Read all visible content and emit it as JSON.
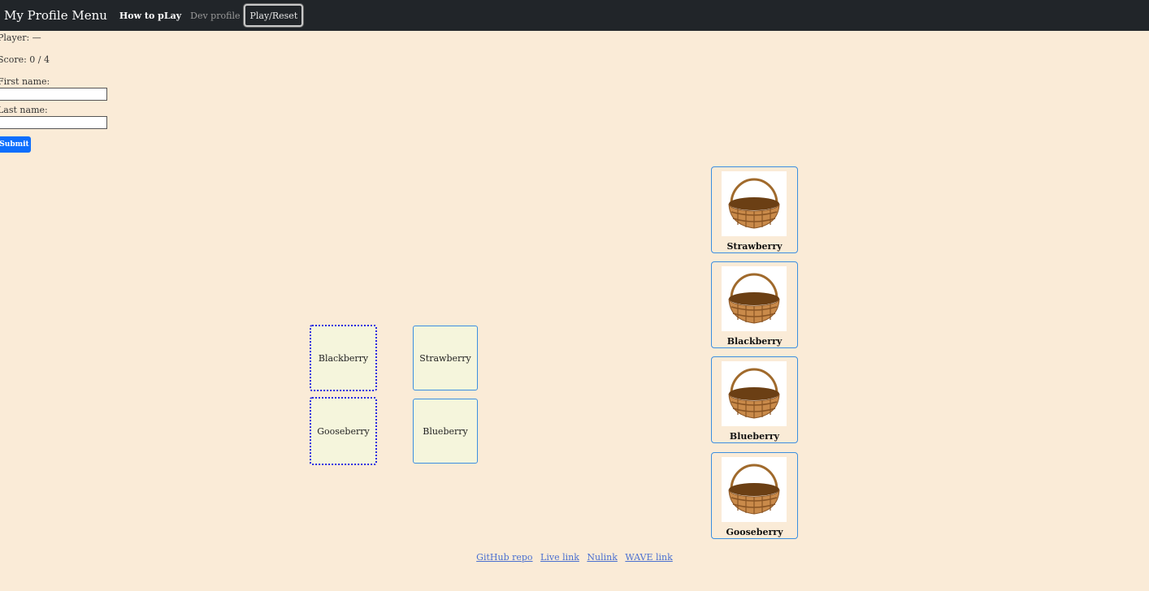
{
  "nav": {
    "brand": "My Profile Menu",
    "links": [
      "How to pLay",
      "Dev profile"
    ],
    "play_button": "Play/Reset"
  },
  "form": {
    "player_label": "Player: —",
    "score_label": "Score: 0 / 4",
    "first_name_label": "First name:",
    "first_name_value": "",
    "last_name_label": "Last name:",
    "last_name_value": "",
    "submit_label": "Submit"
  },
  "fruits": [
    "Blackberry",
    "Strawberry",
    "Gooseberry",
    "Blueberry"
  ],
  "baskets": [
    "Strawberry",
    "Blackberry",
    "Blueberry",
    "Gooseberry"
  ],
  "footer": {
    "links": [
      "GitHub repo",
      "Live link",
      "Nulink",
      "WAVE link"
    ]
  },
  "colors": {
    "page_background": "#faebd7",
    "navbar": "#212529",
    "submit_button": "#0d6efd",
    "fruit_card": "#f5f5dc",
    "card_border": "#3b8fe0",
    "selected_border": "#2a28e0"
  },
  "icons": {
    "basket": "basket-icon"
  }
}
